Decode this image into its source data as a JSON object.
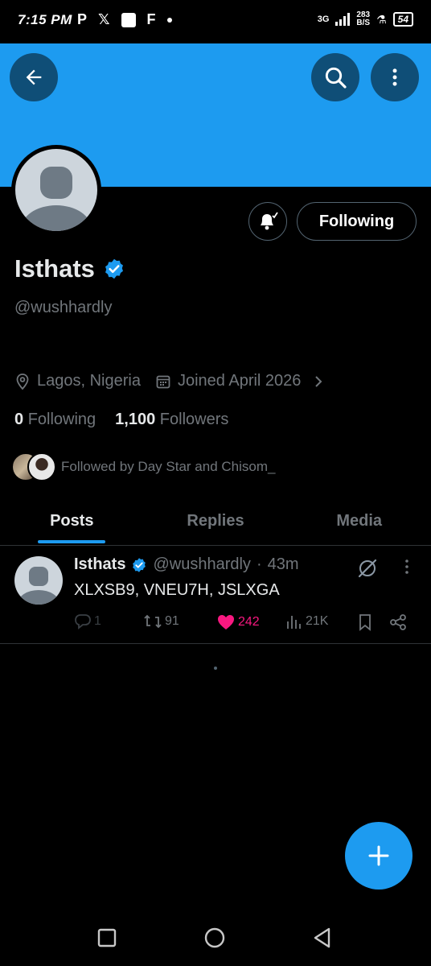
{
  "status_bar": {
    "time": "7:15 PM",
    "network": "3G",
    "speed_value": "283",
    "speed_unit": "B/S",
    "battery": "54"
  },
  "profile": {
    "display_name": "Isthats",
    "handle": "@wushhardly",
    "location": "Lagos, Nigeria",
    "joined": "Joined April 2026",
    "following_count": "0",
    "following_label": "Following",
    "followers_count": "1,100",
    "followers_label": "Followers",
    "followed_by": "Followed by Day Star and Chisom_",
    "follow_button_label": "Following"
  },
  "tabs": [
    {
      "label": "Posts",
      "active": true
    },
    {
      "label": "Replies",
      "active": false
    },
    {
      "label": "Media",
      "active": false
    }
  ],
  "post": {
    "name": "Isthats",
    "handle": "@wushhardly",
    "separator": "·",
    "time": "43m",
    "text": "XLXSB9, VNEU7H, JSLXGA",
    "replies": "1",
    "reposts": "91",
    "likes": "242",
    "views": "21K"
  },
  "colors": {
    "accent": "#1d9bf0",
    "like": "#f91880",
    "muted": "#71767b",
    "banner": "#1d9bf0"
  },
  "icons": [
    "back-arrow-icon",
    "search-icon",
    "more-vertical-icon",
    "bell-icon",
    "verified-badge-icon",
    "location-icon",
    "calendar-icon",
    "chevron-right-icon",
    "reply-icon",
    "repost-icon",
    "heart-icon",
    "views-icon",
    "bookmark-icon",
    "share-icon",
    "grok-icon",
    "compose-plus-icon",
    "nav-square-icon",
    "nav-circle-icon",
    "nav-back-icon"
  ]
}
